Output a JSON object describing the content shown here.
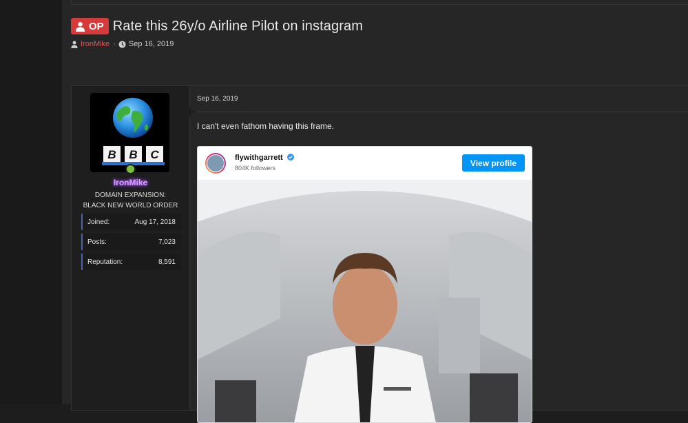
{
  "thread": {
    "op_label": "OP",
    "title": "Rate this 26y/o Airline Pilot on instagram",
    "author": "IronMike",
    "separator": "·",
    "date": "Sep 16, 2019"
  },
  "post": {
    "date": "Sep 16, 2019",
    "message": "I can't even fathom having this frame.",
    "user": {
      "name": "IronMike",
      "title_line1": "DOMAIN EXPANSION:",
      "title_line2": "BLACK NEW WORLD ORDER",
      "avatar_letters": [
        "B",
        "B",
        "C"
      ],
      "stats": [
        {
          "label": "Joined:",
          "value": "Aug 17, 2018"
        },
        {
          "label": "Posts:",
          "value": "7,023"
        },
        {
          "label": "Reputation:",
          "value": "8,591"
        }
      ]
    },
    "instagram": {
      "username": "flywithgarrett",
      "followers": "804K followers",
      "button_label": "View profile"
    }
  },
  "colors": {
    "op_badge": "#d63b3b",
    "author_link": "#e25555",
    "username_glow": "#a44cff",
    "stat_accent": "#4a62b0",
    "ig_button": "#0095f6",
    "online": "#7bbf3b"
  },
  "icons": [
    "user-icon",
    "clock-icon",
    "globe-icon",
    "verified-icon"
  ]
}
